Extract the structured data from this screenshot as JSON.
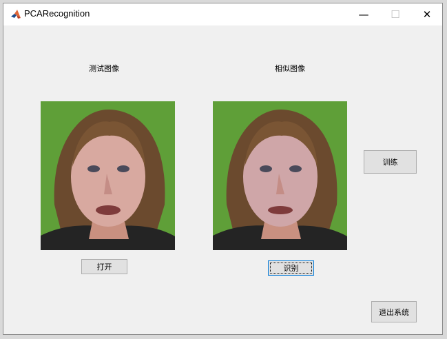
{
  "window": {
    "title": "PCARecognition",
    "controls": {
      "minimize": "—",
      "maximize": "☐",
      "close": "✕"
    }
  },
  "panels": {
    "test_image_label": "测试图像",
    "similar_image_label": "相似图像"
  },
  "buttons": {
    "open": "打开",
    "recognize": "识别",
    "train": "训练",
    "exit": "退出系统"
  },
  "icons": {
    "app": "matlab-icon"
  },
  "colors": {
    "window_bg": "#f0f0f0",
    "photo_bg": "#5c9e35",
    "focus_border": "#0078d7"
  }
}
